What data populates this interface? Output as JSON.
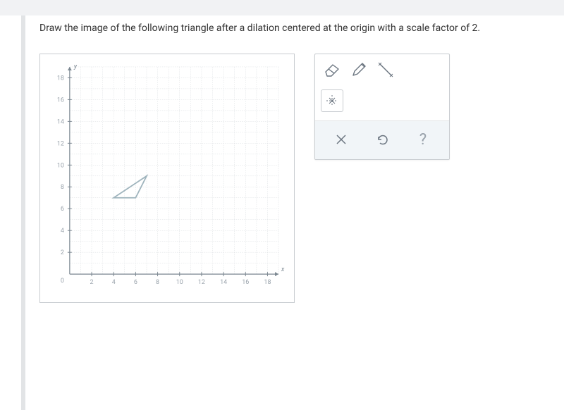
{
  "question": "Draw the image of the following triangle after a dilation centered at the origin with a scale factor of 2.",
  "graph": {
    "x_label": "x",
    "y_label": "y",
    "origin_label": "0",
    "x_ticks": [
      2,
      4,
      6,
      8,
      10,
      12,
      14,
      16,
      18
    ],
    "y_ticks": [
      2,
      4,
      6,
      8,
      10,
      12,
      14,
      16,
      18
    ],
    "x_min": 0,
    "x_max": 19,
    "y_min": 0,
    "y_max": 19,
    "triangle": [
      [
        4,
        7
      ],
      [
        7,
        9
      ],
      [
        6,
        7
      ]
    ],
    "grid_color": "#d8dcdf",
    "triangle_color": "#9fb4bd"
  },
  "tools": {
    "eraser": "eraser-icon",
    "pencil": "pencil-icon",
    "line": "line-icon",
    "origin_marker": "origin-marker-icon"
  },
  "actions": {
    "close_label": "×",
    "reset": "reset-icon",
    "help_label": "?"
  }
}
